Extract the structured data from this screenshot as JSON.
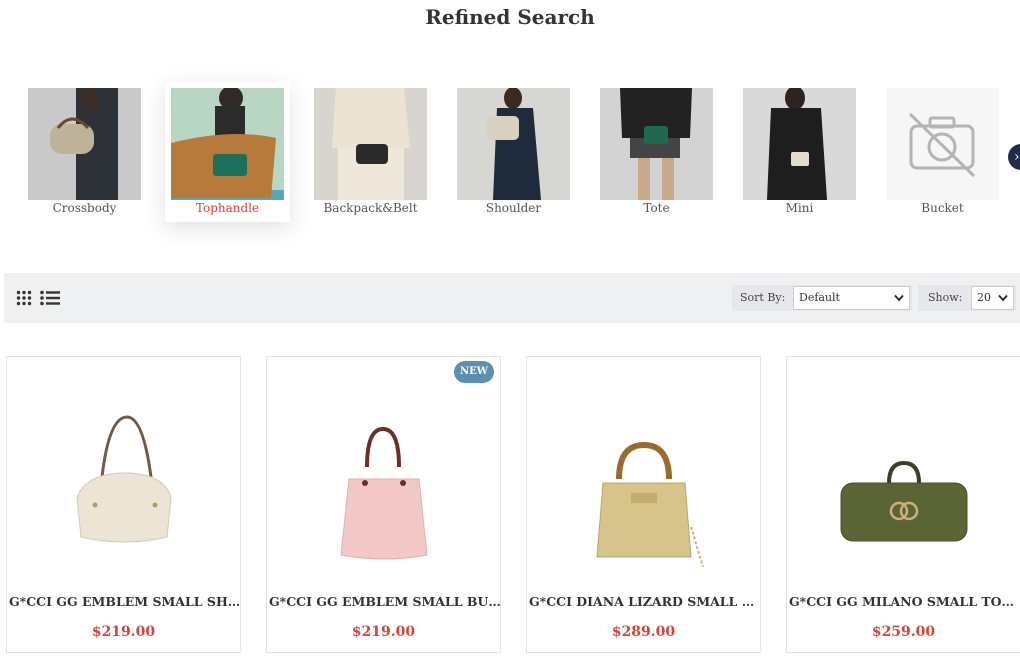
{
  "page": {
    "title": "Refined Search"
  },
  "categories": [
    {
      "label": "Crossbody",
      "icon": "crossbody-bag-photo"
    },
    {
      "label": "Tophandle",
      "icon": "tophandle-bag-photo",
      "active": true
    },
    {
      "label": "Backpack&Belt",
      "icon": "belt-bag-photo"
    },
    {
      "label": "Shoulder",
      "icon": "shoulder-bag-photo"
    },
    {
      "label": "Tote",
      "icon": "tote-bag-photo"
    },
    {
      "label": "Mini",
      "icon": "mini-bag-photo"
    },
    {
      "label": "Bucket",
      "icon": "no-image-icon"
    }
  ],
  "toolbar": {
    "sort_label": "Sort By:",
    "sort_value": "Default",
    "show_label": "Show:",
    "show_value": "20"
  },
  "products": [
    {
      "name": "G*CCI GG EMBLEM SMALL SHOU...",
      "price": "$219.00",
      "badge": ""
    },
    {
      "name": "G*CCI GG EMBLEM SMALL BUCK...",
      "price": "$219.00",
      "badge": "NEW"
    },
    {
      "name": "G*CCI DIANA LIZARD SMALL TOT...",
      "price": "$289.00",
      "badge": ""
    },
    {
      "name": "G*CCI GG MILANO SMALL TOP H...",
      "price": "$259.00",
      "badge": ""
    }
  ],
  "colors": {
    "accent": "#d0463a",
    "badge": "#5d8fb0",
    "toolbar_bg": "#eff0f2"
  }
}
